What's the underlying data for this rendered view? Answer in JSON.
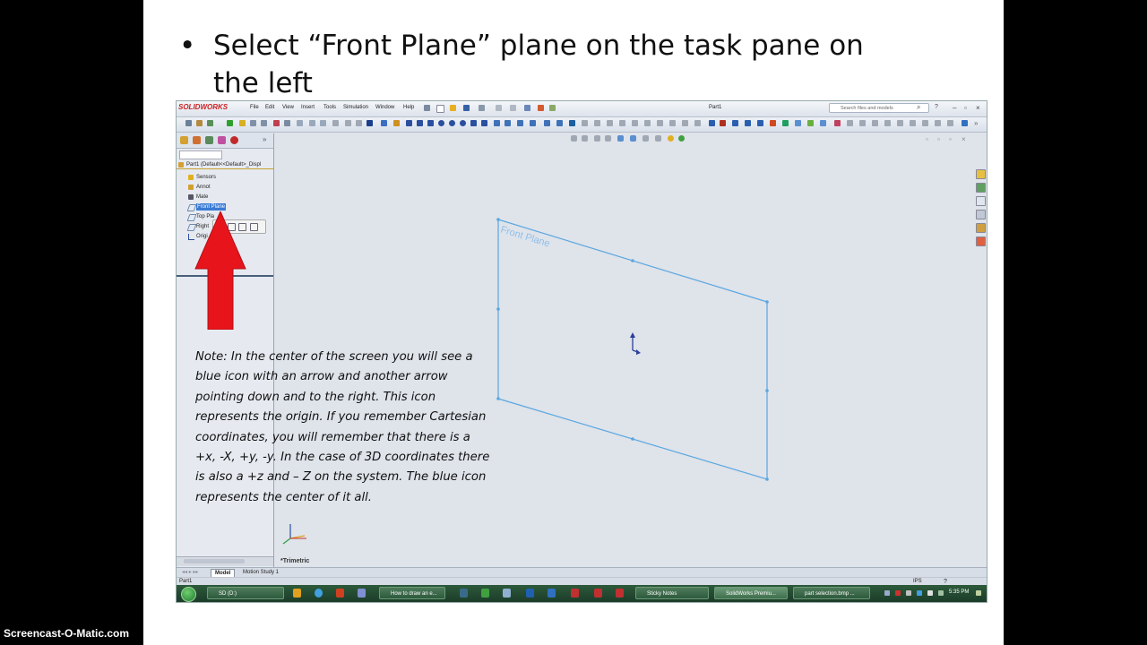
{
  "slide": {
    "bullet_char": "•",
    "bullet_text": "Select “Front Plane” plane on the task pane on the left",
    "note": "Note: In the center of the screen you will see a blue icon with an arrow and another arrow pointing down and to the right. This icon represents the origin. If you remember Cartesian coordinates, you will remember that there is a +x, -X, +y, -y. In the case of 3D coordinates there is also a +z and – Z on the system. The blue icon represents the center of it all."
  },
  "app": {
    "logo": "SOLIDWORKS",
    "menus": [
      "File",
      "Edit",
      "View",
      "Insert",
      "Tools",
      "Simulation",
      "Window",
      "Help"
    ],
    "document_title": "Part1",
    "search_placeholder": "Search files and models",
    "window_controls": [
      "–",
      "▫",
      "×"
    ]
  },
  "feature_tree": {
    "root": "Part1 (Default<<Default>_Displ",
    "items": [
      {
        "label": "Sensors",
        "icon": "sensors-icon"
      },
      {
        "label": "Annot",
        "icon": "annotations-icon"
      },
      {
        "label": "Mate",
        "icon": "material-icon"
      },
      {
        "label": "Front Plane",
        "icon": "plane-icon",
        "selected": true
      },
      {
        "label": "Top Pla",
        "icon": "plane-icon"
      },
      {
        "label": "Right",
        "icon": "plane-icon"
      },
      {
        "label": "Origi",
        "icon": "origin-icon"
      }
    ]
  },
  "viewport": {
    "plane_label": "Front Plane",
    "view_name": "*Trimetric"
  },
  "bottom_tabs": [
    "Model",
    "Motion Study 1"
  ],
  "status": {
    "left": "Part1",
    "units": "IPS"
  },
  "taskbar": {
    "buttons": [
      {
        "label": "SD (D:)",
        "icon": "folder-icon"
      },
      {
        "label": "How to draw an e...",
        "icon": "word-icon"
      },
      {
        "label": "Sticky Notes",
        "icon": "sticky-notes-icon"
      },
      {
        "label": "SolidWorks Premiu...",
        "icon": "solidworks-icon"
      },
      {
        "label": "part selection.bmp ...",
        "icon": "paint-icon"
      }
    ],
    "clock": "5:35 PM"
  },
  "watermark": "Screencast-O-Matic.com",
  "colors": {
    "plane_blue": "#5aa7e0",
    "selection_blue": "#3a7bd5",
    "arrow_red": "#e8141c",
    "taskbar_green": "#2c5a3a"
  }
}
